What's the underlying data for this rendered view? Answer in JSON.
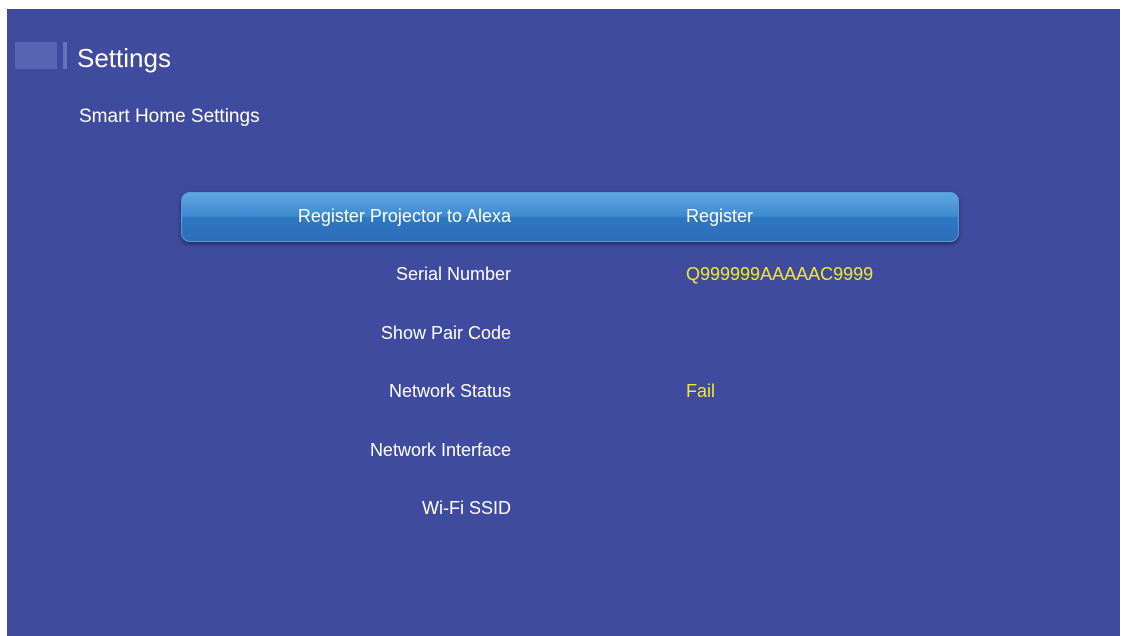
{
  "header": {
    "title": "Settings",
    "logo_icon": "settings-logo-icon"
  },
  "section": {
    "title": "Smart Home Settings"
  },
  "colors": {
    "background": "#3f4b9f",
    "highlight": "#3d8ad0",
    "value_yellow": "#f2ea27"
  },
  "settings": [
    {
      "label": "Register Projector to Alexa",
      "value": "Register",
      "selected": true
    },
    {
      "label": "Serial Number",
      "value": "Q999999AAAAAC9999",
      "selected": false
    },
    {
      "label": "Show Pair Code",
      "value": "",
      "selected": false
    },
    {
      "label": "Network Status",
      "value": "Fail",
      "selected": false
    },
    {
      "label": "Network Interface",
      "value": "",
      "selected": false
    },
    {
      "label": "Wi-Fi SSID",
      "value": "",
      "selected": false
    }
  ]
}
